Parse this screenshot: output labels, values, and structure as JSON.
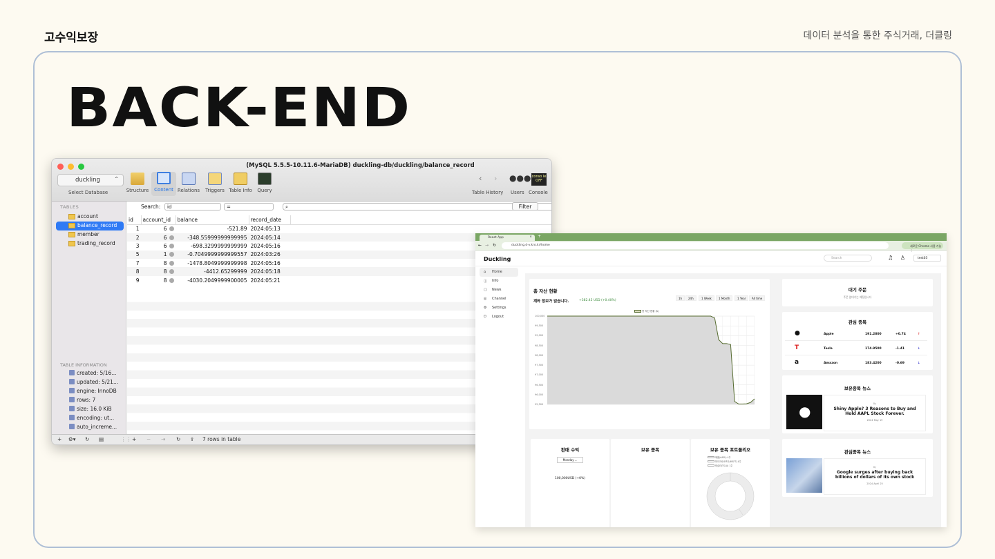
{
  "slide": {
    "brand": "고수익보장",
    "subtitle": "데이터 분석을 통한 주식거래, 더클링",
    "title": "BACK-END"
  },
  "sequel": {
    "window_title": "(MySQL 5.5.5-10.11.6-MariaDB) duckling-db/duckling/balance_record",
    "database": "duckling",
    "select_db_label": "Select Database",
    "toolbar": [
      "Structure",
      "Content",
      "Relations",
      "Triggers",
      "Table Info",
      "Query"
    ],
    "toolbar_active": "Content",
    "toolbar_right": [
      "Table History",
      "Users",
      "Console"
    ],
    "console_icon_text": "conso le OFF",
    "tables_header": "TABLES",
    "tables": [
      "account",
      "balance_record",
      "member",
      "trading_record"
    ],
    "selected_table": "balance_record",
    "info_header": "TABLE INFORMATION",
    "info": [
      "created: 5/16...",
      "updated: 5/21...",
      "engine: InnoDB",
      "rows: 7",
      "size: 16.0 KiB",
      "encoding: ut...",
      "auto_increme..."
    ],
    "search_label": "Search:",
    "search_field": "id",
    "search_op": "=",
    "filter_button": "Filter",
    "columns": [
      "id",
      "account_id",
      "balance",
      "record_date"
    ],
    "rows": [
      [
        "1",
        "6",
        "-521.89",
        "2024:05:13"
      ],
      [
        "2",
        "6",
        "-348.55999999999995",
        "2024:05:14"
      ],
      [
        "3",
        "6",
        "-698.3299999999999",
        "2024:05:16"
      ],
      [
        "5",
        "1",
        "-0.7049999999999557",
        "2024:03:26"
      ],
      [
        "7",
        "8",
        "-1478.8049999999998",
        "2024:05:16"
      ],
      [
        "8",
        "8",
        "-4412.65299999",
        "2024:05:18"
      ],
      [
        "9",
        "8",
        "-4030.2049999900005",
        "2024:05:21"
      ]
    ],
    "status": "7 rows in table"
  },
  "browser": {
    "tab_title": "React App",
    "url": "duckling.d-v.kro.kr/home",
    "chrome_btn": "새로운 Chrome 사용 가능 ⋮",
    "logo": "Duckling",
    "search_placeholder": "Search",
    "user": "test03",
    "nav": [
      "Home",
      "Info",
      "News",
      "Channel",
      "Settings",
      "Logout"
    ],
    "asset": {
      "title": "총 자산 현황",
      "subtitle": "계좌 정보가 없습니다.",
      "delta": "+382.45 USD (+0.40%)",
      "ranges": [
        "1h",
        "24h",
        "1 Week",
        "1 Month",
        "1 Year",
        "All time"
      ],
      "legend": "총 자산 현황 ($)"
    },
    "chart_data": {
      "type": "area",
      "y_ticks": [
        "100,000",
        "99,500",
        "99,000",
        "98,500",
        "98,000",
        "97,500",
        "97,000",
        "96,500",
        "96,000",
        "95,500"
      ],
      "ylim": [
        95500,
        100000
      ],
      "values": [
        100000,
        100000,
        100000,
        100000,
        100000,
        100000,
        100000,
        100000,
        100000,
        100000,
        100000,
        100000,
        100000,
        100000,
        100000,
        100000,
        100000,
        100000,
        100000,
        100000,
        100000,
        100000,
        100000,
        100000,
        100000,
        100000,
        100000,
        100000,
        100000,
        100000,
        100000,
        100000,
        100000,
        100000,
        100000,
        100000,
        100000,
        100000,
        100000,
        100000,
        100000,
        100000,
        99900,
        98800,
        98600,
        98600,
        98550,
        95650,
        95520,
        95520,
        95530,
        95600,
        95780
      ],
      "grid": true
    },
    "pending": {
      "title": "대기 주문",
      "empty": "주문 없대기는 예정입니다"
    },
    "watchlist": {
      "title": "관심 종목",
      "rows": [
        {
          "name": "Apple",
          "price": "191.2800",
          "change": "+0.74",
          "arrow": "↑",
          "arrow_color": "#d33"
        },
        {
          "name": "Tesla",
          "price": "174.9500",
          "change": "-1.41",
          "arrow": "↓",
          "arrow_color": "#33c"
        },
        {
          "name": "Amazon",
          "price": "183.4200",
          "change": "-0.69",
          "arrow": "↓",
          "arrow_color": "#33c"
        }
      ]
    },
    "holding_news": {
      "title": "보유종목 뉴스",
      "source": "By",
      "headline": "Shiny Apple? 3 Reasons to Buy and Hold AAPL Stock Forever.",
      "date": "2024 May 19"
    },
    "watch_news": {
      "title": "관심종목 뉴스",
      "source": "By",
      "headline": "Google surges after buying back billions of dollars of its own stock",
      "date": "2024 April 25"
    },
    "sell_profit": {
      "title": "판매 수익",
      "period": "Monday",
      "value": "100,000USD (+0%)"
    },
    "holdings": {
      "title": "보유 종목"
    },
    "portfolio": {
      "title": "보유 종목 포트폴리오",
      "legend": [
        "애플(AAPL) 4주",
        "마이크로소프트(MSFT) 4주",
        "테슬라(TSLA) 1주"
      ]
    }
  }
}
